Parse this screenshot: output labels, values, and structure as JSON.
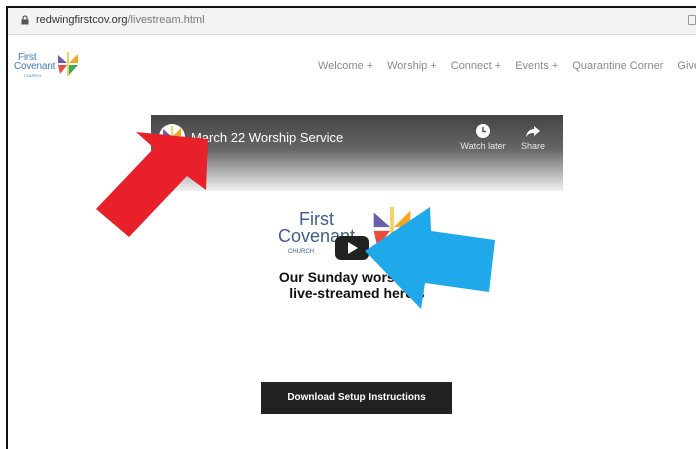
{
  "browser": {
    "url_domain": "redwingfirstcov.org",
    "url_path": "/livestream.html"
  },
  "site": {
    "logo_line1": "First",
    "logo_line2": "Covenant",
    "logo_line3": "CHURCH"
  },
  "nav": {
    "items": [
      {
        "label": "Welcome +"
      },
      {
        "label": "Worship +"
      },
      {
        "label": "Connect +"
      },
      {
        "label": "Events +"
      },
      {
        "label": "Quarantine Corner"
      },
      {
        "label": "Give Now!"
      }
    ]
  },
  "video": {
    "title": "March 22 Worship Service",
    "watch_later_label": "Watch later",
    "share_label": "Share",
    "logo_line1": "First",
    "logo_line2": "Covenant",
    "logo_line3": "CHURCH",
    "message_line1": "Our Sunday worship se",
    "message_line2": "live-streamed here s"
  },
  "download": {
    "label": "Download Setup Instructions"
  },
  "colors": {
    "red_arrow": "#e8202a",
    "blue_arrow": "#1fa9ea",
    "button_bg": "#222222"
  }
}
